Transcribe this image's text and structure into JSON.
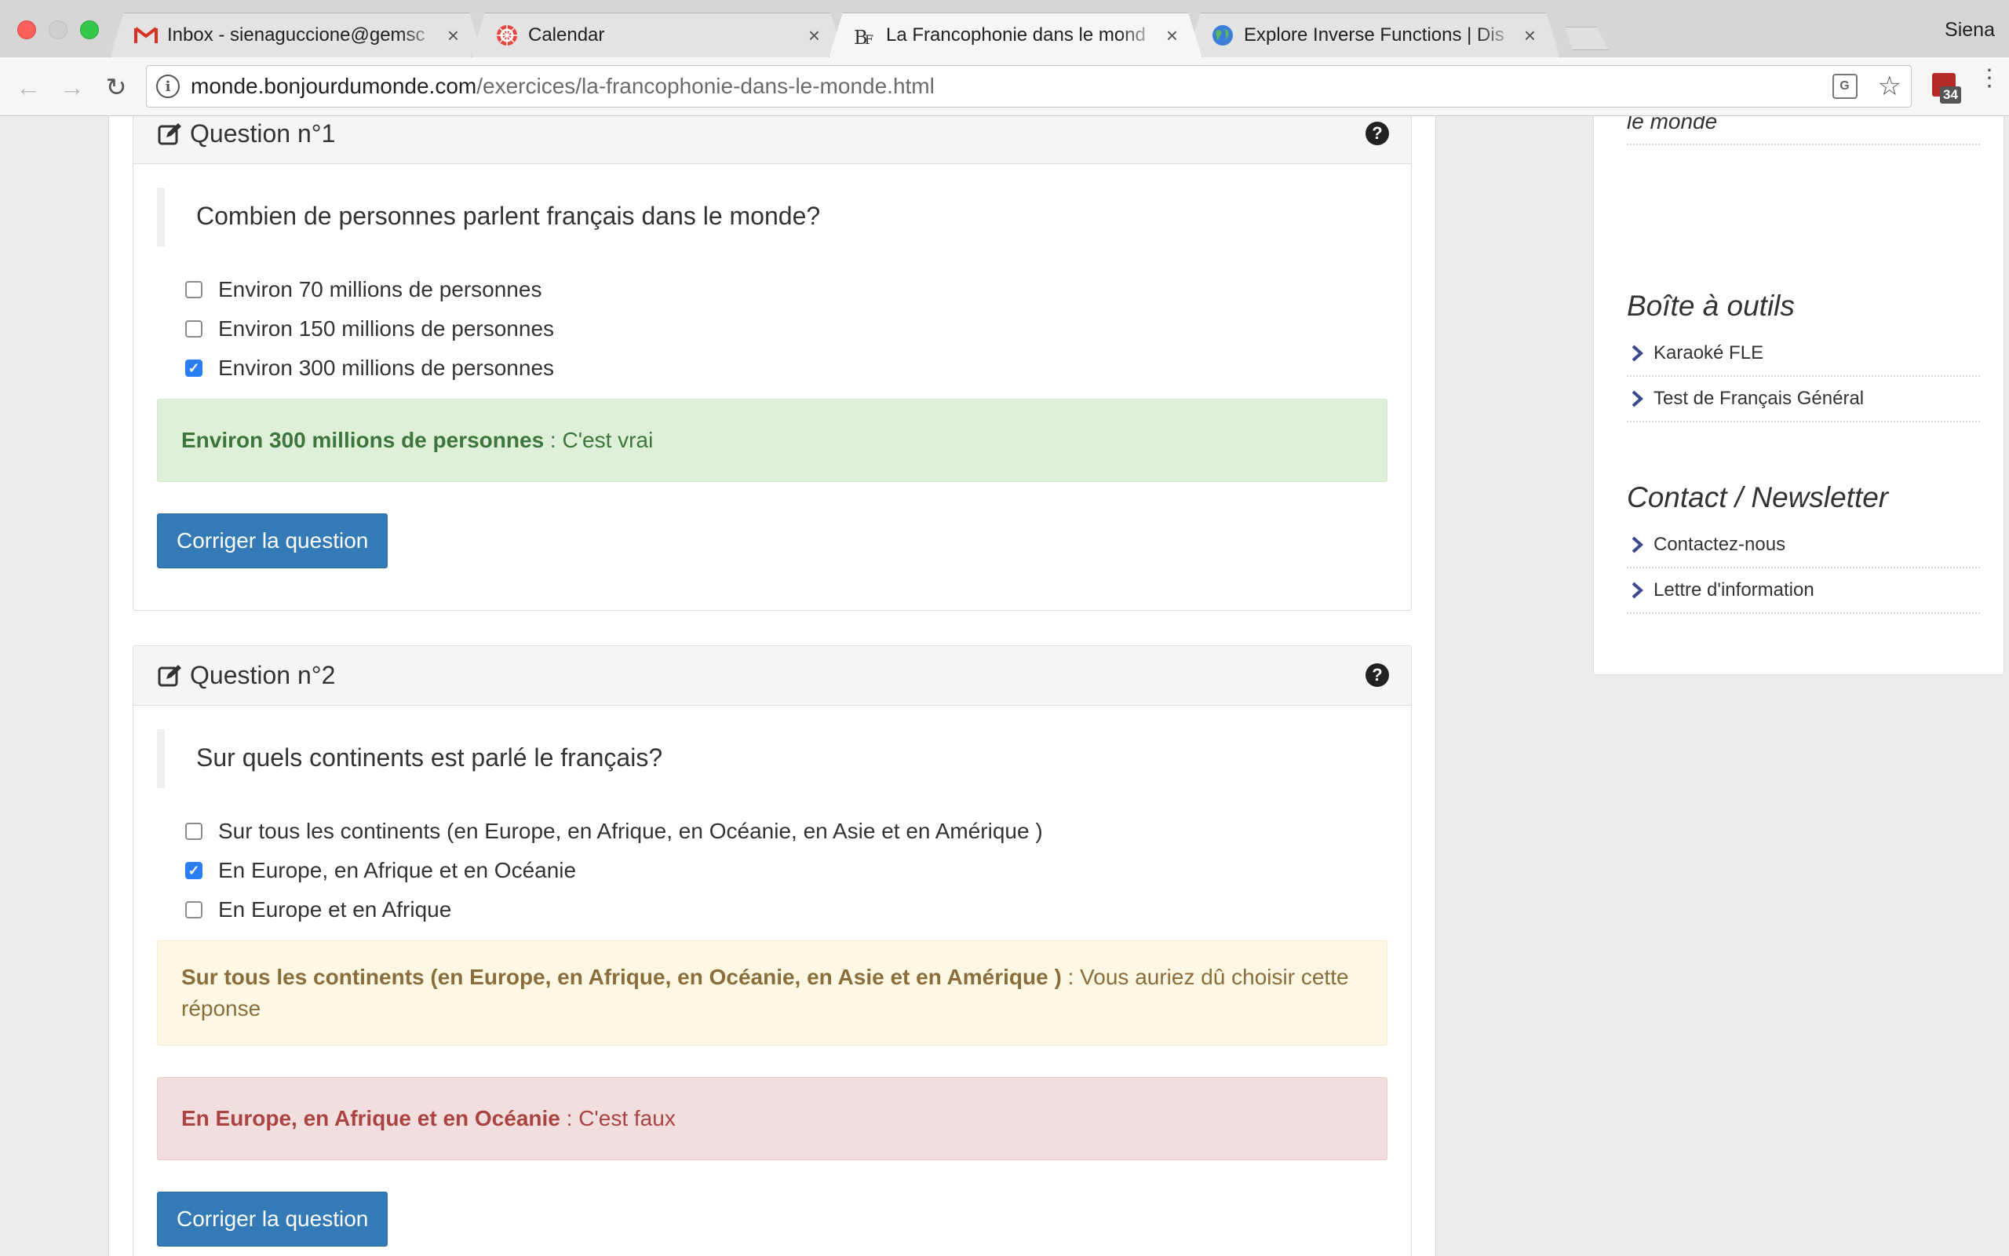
{
  "browser": {
    "tabs": [
      {
        "title": "Inbox - sienaguccione@gemsc",
        "icon": "gmail-icon"
      },
      {
        "title": "Calendar",
        "icon": "calendar-icon"
      },
      {
        "title": "La Francophonie dans le mond",
        "icon": "bf-icon"
      },
      {
        "title": "Explore Inverse Functions | Dis",
        "icon": "globe-icon"
      }
    ],
    "close_glyph": "×",
    "profile_name": "Siena",
    "url_host": "monde.bonjourdumonde.com",
    "url_path": "/exercices/la-francophonie-dans-le-monde.html",
    "extension_badge": "34"
  },
  "questions": [
    {
      "title": "Question n°1",
      "prompt": "Combien de personnes parlent français dans le monde?",
      "options": [
        {
          "label": "Environ 70 millions de personnes",
          "checked": false
        },
        {
          "label": "Environ 150 millions de personnes",
          "checked": false
        },
        {
          "label": "Environ 300 millions de personnes",
          "checked": true
        }
      ],
      "feedback": [
        {
          "type": "success",
          "answer": "Environ 300 millions de personnes",
          "message": " : C'est vrai"
        }
      ],
      "button_label": "Corriger la question"
    },
    {
      "title": "Question n°2",
      "prompt": "Sur quels continents est parlé le français?",
      "options": [
        {
          "label": "Sur tous les continents (en Europe, en Afrique, en Océanie, en Asie et en Amérique )",
          "checked": false
        },
        {
          "label": "En Europe, en Afrique et en Océanie",
          "checked": true
        },
        {
          "label": "En Europe et en Afrique",
          "checked": false
        }
      ],
      "feedback": [
        {
          "type": "warning",
          "answer": "Sur tous les continents (en Europe, en Afrique, en Océanie, en Asie et en Amérique )",
          "message": " : Vous auriez dû choisir cette réponse"
        },
        {
          "type": "danger",
          "answer": "En Europe, en Afrique et en Océanie",
          "message": " : C'est faux"
        }
      ],
      "button_label": "Corriger la question"
    }
  ],
  "sidebar": {
    "top_link": "le monde",
    "sections": [
      {
        "heading": "Boîte à outils",
        "links": [
          "Karaoké FLE",
          "Test de Français Général"
        ]
      },
      {
        "heading": "Contact / Newsletter",
        "links": [
          "Contactez-nous",
          "Lettre d'information"
        ]
      }
    ]
  },
  "colors": {
    "primary_button": "#337ab7",
    "success_bg": "#dff0d8",
    "warning_bg": "#fcf8e3",
    "danger_bg": "#f2dede",
    "checkbox_checked": "#2a7ef3"
  }
}
